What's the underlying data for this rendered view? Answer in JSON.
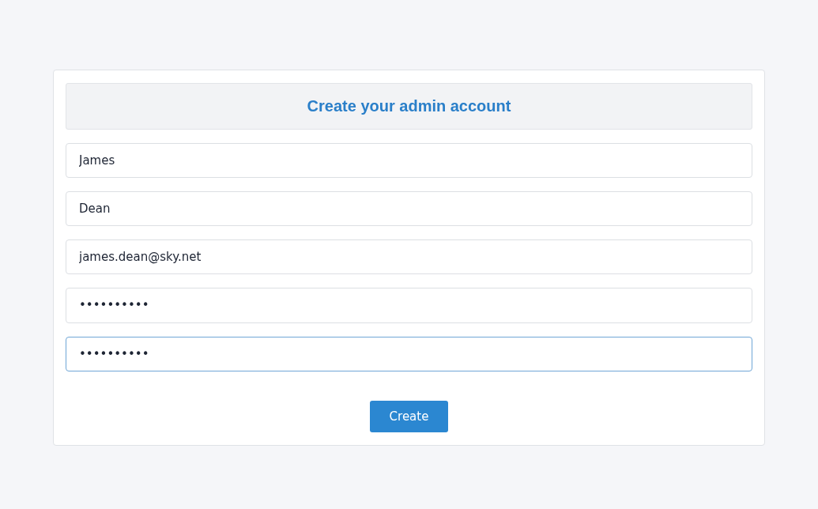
{
  "form": {
    "title": "Create your admin account",
    "fields": [
      {
        "value": "James",
        "focused": false
      },
      {
        "value": "Dean",
        "focused": false
      },
      {
        "value": "james.dean@sky.net",
        "focused": false
      },
      {
        "value": "••••••••••",
        "focused": false
      },
      {
        "value": "••••••••••",
        "focused": true
      }
    ],
    "button": "Create"
  }
}
